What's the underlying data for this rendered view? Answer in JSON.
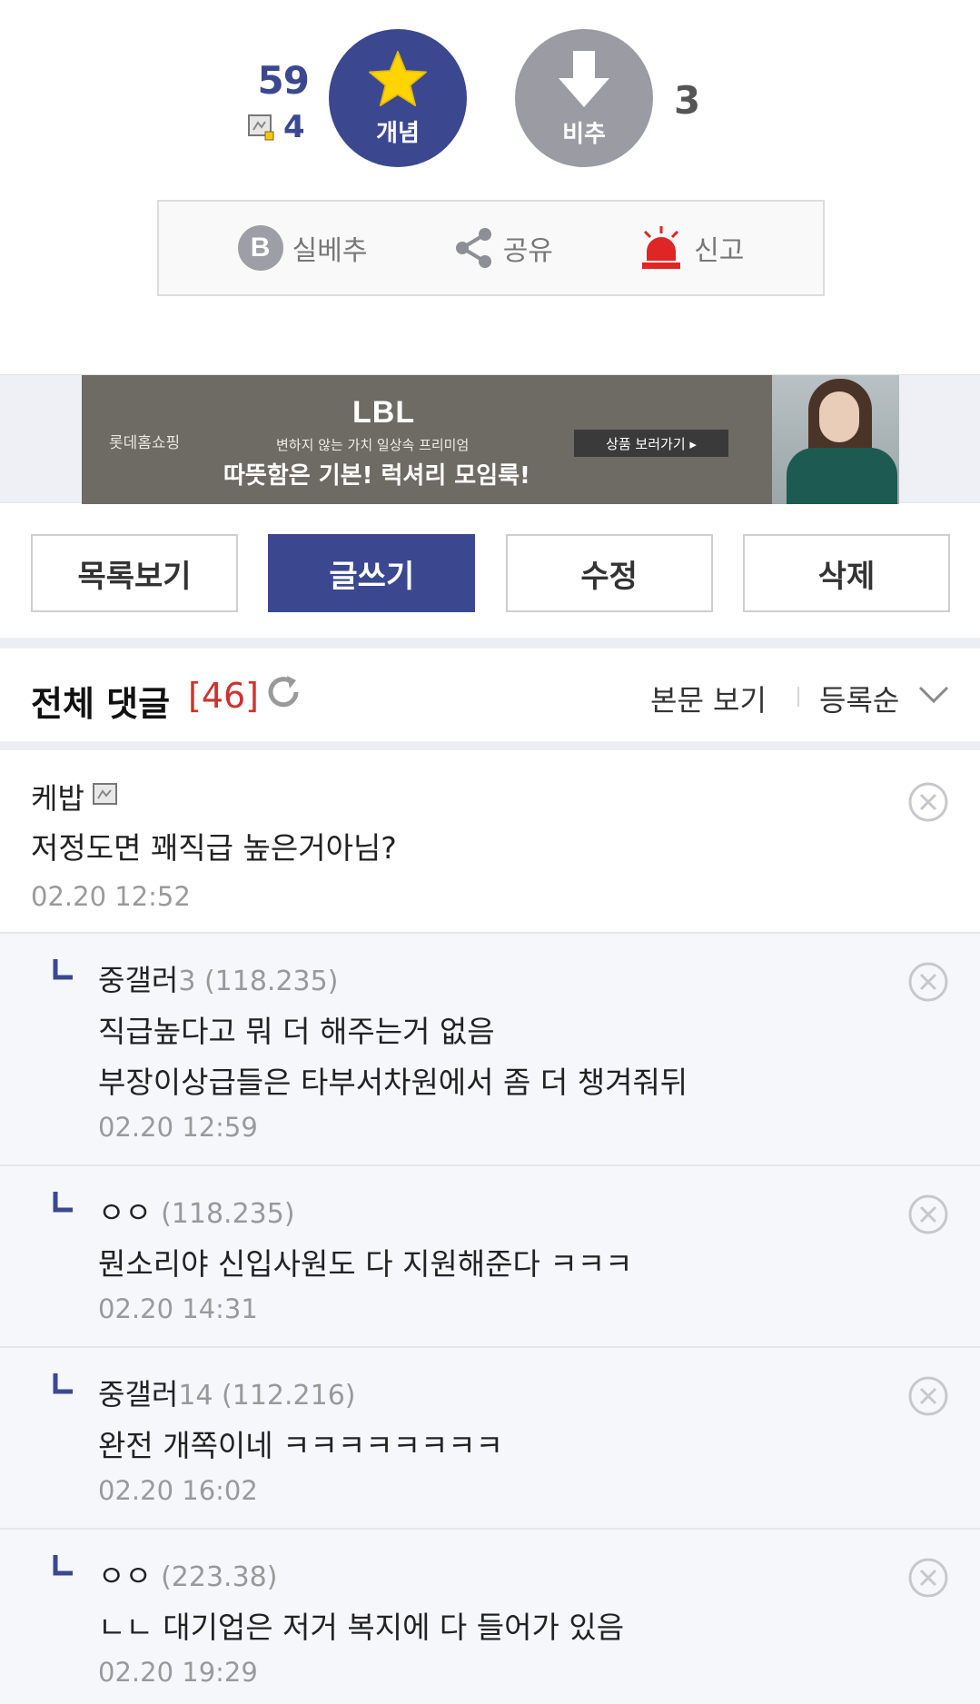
{
  "vote": {
    "up_count": "59",
    "fixed_count": "4",
    "up_label": "개념",
    "down_label": "비추",
    "down_count": "3"
  },
  "actions": {
    "best_label": "실베추",
    "best_icon_letter": "B",
    "share_label": "공유",
    "report_label": "신고"
  },
  "ad": {
    "brand": "롯데홈쇼핑",
    "logo": "LBL",
    "sub": "변하지 않는 가치 일상속 프리미엄",
    "title": "따뜻함은 기본! 럭셔리 모임룩!",
    "cta": "상품 보러가기 ▸"
  },
  "post_buttons": {
    "list": "목록보기",
    "write": "글쓰기",
    "edit": "수정",
    "delete": "삭제"
  },
  "comment_header": {
    "title": "전체 댓글",
    "count": "[46]",
    "view_label": "본문 보기",
    "sort_label": "등록순"
  },
  "comments": [
    {
      "name": "케밥",
      "meta": "",
      "lines": [
        "저정도면 꽤직급 높은거아님?"
      ],
      "date": "02.20 12:52"
    },
    {
      "name": "중갤러",
      "meta": "3 (118.235)",
      "lines": [
        "직급높다고 뭐 더 해주는거 없음",
        "부장이상급들은 타부서차원에서 좀 더 챙겨줘뒤"
      ],
      "date": "02.20 12:59"
    },
    {
      "name": "ㅇㅇ",
      "meta": "(118.235)",
      "lines": [
        "뭔소리야 신입사원도 다 지원해준다 ㅋㅋㅋ"
      ],
      "date": "02.20 14:31"
    },
    {
      "name": "중갤러",
      "meta": "14 (112.216)",
      "lines": [
        "완전 개쪽이네 ㅋㅋㅋㅋㅋㅋㅋㅋ"
      ],
      "date": "02.20 16:02"
    },
    {
      "name": "ㅇㅇ",
      "meta": "(223.38)",
      "lines": [
        "ㄴㄴ 대기업은 저거 복지에 다 들어가 있음"
      ],
      "date": "02.20 19:29"
    }
  ],
  "colors": {
    "brand": "#3b4890",
    "downvote": "#9b9ba3",
    "report": "#e02525",
    "count_red": "#d0312d"
  },
  "icons": [
    "star-icon",
    "arrow-down-icon",
    "fixed-member-icon",
    "share-icon",
    "siren-icon",
    "refresh-icon",
    "chevron-down-icon",
    "delete-circle-icon",
    "reply-arrow-icon"
  ]
}
